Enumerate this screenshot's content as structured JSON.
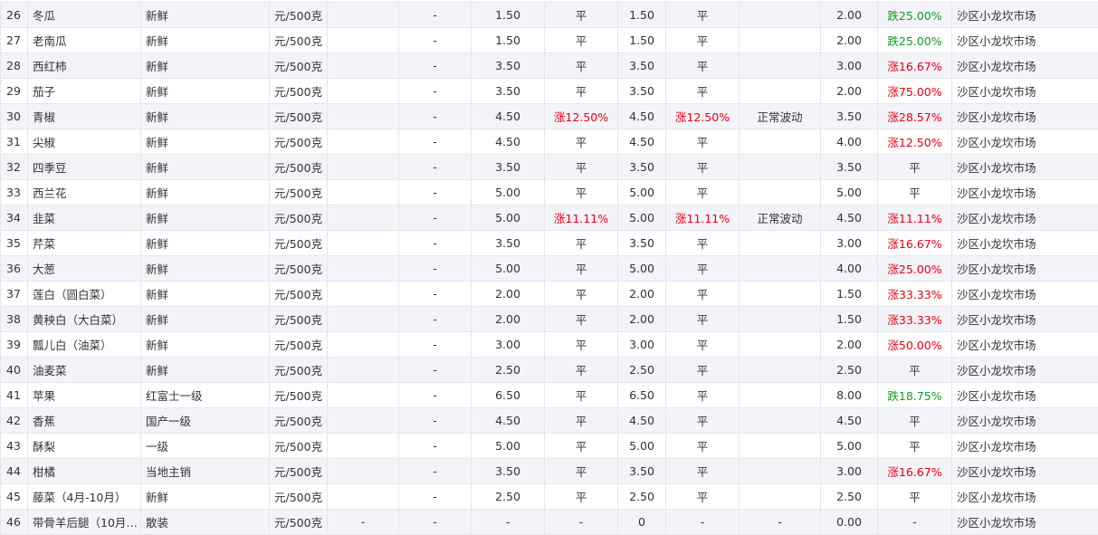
{
  "table": {
    "rows": [
      {
        "idx": "26",
        "name": "冬瓜",
        "spec": "新鲜",
        "unit": "元/500克",
        "c5": "",
        "c6": "-",
        "price1": "1.50",
        "change1": "平",
        "price2": "1.50",
        "change2": "平",
        "note": "",
        "price3": "2.00",
        "change3": "跌25.00%",
        "market": "沙区小龙坎市场"
      },
      {
        "idx": "27",
        "name": "老南瓜",
        "spec": "新鲜",
        "unit": "元/500克",
        "c5": "",
        "c6": "-",
        "price1": "1.50",
        "change1": "平",
        "price2": "1.50",
        "change2": "平",
        "note": "",
        "price3": "2.00",
        "change3": "跌25.00%",
        "market": "沙区小龙坎市场"
      },
      {
        "idx": "28",
        "name": "西红柿",
        "spec": "新鲜",
        "unit": "元/500克",
        "c5": "",
        "c6": "-",
        "price1": "3.50",
        "change1": "平",
        "price2": "3.50",
        "change2": "平",
        "note": "",
        "price3": "3.00",
        "change3": "涨16.67%",
        "market": "沙区小龙坎市场"
      },
      {
        "idx": "29",
        "name": "茄子",
        "spec": "新鲜",
        "unit": "元/500克",
        "c5": "",
        "c6": "-",
        "price1": "3.50",
        "change1": "平",
        "price2": "3.50",
        "change2": "平",
        "note": "",
        "price3": "2.00",
        "change3": "涨75.00%",
        "market": "沙区小龙坎市场"
      },
      {
        "idx": "30",
        "name": "青椒",
        "spec": "新鲜",
        "unit": "元/500克",
        "c5": "",
        "c6": "-",
        "price1": "4.50",
        "change1": "涨12.50%",
        "price2": "4.50",
        "change2": "涨12.50%",
        "note": "正常波动",
        "price3": "3.50",
        "change3": "涨28.57%",
        "market": "沙区小龙坎市场"
      },
      {
        "idx": "31",
        "name": "尖椒",
        "spec": "新鲜",
        "unit": "元/500克",
        "c5": "",
        "c6": "-",
        "price1": "4.50",
        "change1": "平",
        "price2": "4.50",
        "change2": "平",
        "note": "",
        "price3": "4.00",
        "change3": "涨12.50%",
        "market": "沙区小龙坎市场"
      },
      {
        "idx": "32",
        "name": "四季豆",
        "spec": "新鲜",
        "unit": "元/500克",
        "c5": "",
        "c6": "-",
        "price1": "3.50",
        "change1": "平",
        "price2": "3.50",
        "change2": "平",
        "note": "",
        "price3": "3.50",
        "change3": "平",
        "market": "沙区小龙坎市场"
      },
      {
        "idx": "33",
        "name": "西兰花",
        "spec": "新鲜",
        "unit": "元/500克",
        "c5": "",
        "c6": "-",
        "price1": "5.00",
        "change1": "平",
        "price2": "5.00",
        "change2": "平",
        "note": "",
        "price3": "5.00",
        "change3": "平",
        "market": "沙区小龙坎市场"
      },
      {
        "idx": "34",
        "name": "韭菜",
        "spec": "新鲜",
        "unit": "元/500克",
        "c5": "",
        "c6": "-",
        "price1": "5.00",
        "change1": "涨11.11%",
        "price2": "5.00",
        "change2": "涨11.11%",
        "note": "正常波动",
        "price3": "4.50",
        "change3": "涨11.11%",
        "market": "沙区小龙坎市场"
      },
      {
        "idx": "35",
        "name": "芹菜",
        "spec": "新鲜",
        "unit": "元/500克",
        "c5": "",
        "c6": "-",
        "price1": "3.50",
        "change1": "平",
        "price2": "3.50",
        "change2": "平",
        "note": "",
        "price3": "3.00",
        "change3": "涨16.67%",
        "market": "沙区小龙坎市场"
      },
      {
        "idx": "36",
        "name": "大葱",
        "spec": "新鲜",
        "unit": "元/500克",
        "c5": "",
        "c6": "-",
        "price1": "5.00",
        "change1": "平",
        "price2": "5.00",
        "change2": "平",
        "note": "",
        "price3": "4.00",
        "change3": "涨25.00%",
        "market": "沙区小龙坎市场"
      },
      {
        "idx": "37",
        "name": "莲白（圆白菜）",
        "spec": "新鲜",
        "unit": "元/500克",
        "c5": "",
        "c6": "-",
        "price1": "2.00",
        "change1": "平",
        "price2": "2.00",
        "change2": "平",
        "note": "",
        "price3": "1.50",
        "change3": "涨33.33%",
        "market": "沙区小龙坎市场"
      },
      {
        "idx": "38",
        "name": "黄秧白（大白菜）",
        "spec": "新鲜",
        "unit": "元/500克",
        "c5": "",
        "c6": "-",
        "price1": "2.00",
        "change1": "平",
        "price2": "2.00",
        "change2": "平",
        "note": "",
        "price3": "1.50",
        "change3": "涨33.33%",
        "market": "沙区小龙坎市场"
      },
      {
        "idx": "39",
        "name": "瓢儿白（油菜）",
        "spec": "新鲜",
        "unit": "元/500克",
        "c5": "",
        "c6": "-",
        "price1": "3.00",
        "change1": "平",
        "price2": "3.00",
        "change2": "平",
        "note": "",
        "price3": "2.00",
        "change3": "涨50.00%",
        "market": "沙区小龙坎市场"
      },
      {
        "idx": "40",
        "name": "油麦菜",
        "spec": "新鲜",
        "unit": "元/500克",
        "c5": "",
        "c6": "-",
        "price1": "2.50",
        "change1": "平",
        "price2": "2.50",
        "change2": "平",
        "note": "",
        "price3": "2.50",
        "change3": "平",
        "market": "沙区小龙坎市场"
      },
      {
        "idx": "41",
        "name": "苹果",
        "spec": "红富士一级",
        "unit": "元/500克",
        "c5": "",
        "c6": "-",
        "price1": "6.50",
        "change1": "平",
        "price2": "6.50",
        "change2": "平",
        "note": "",
        "price3": "8.00",
        "change3": "跌18.75%",
        "market": "沙区小龙坎市场"
      },
      {
        "idx": "42",
        "name": "香蕉",
        "spec": "国产一级",
        "unit": "元/500克",
        "c5": "",
        "c6": "-",
        "price1": "4.50",
        "change1": "平",
        "price2": "4.50",
        "change2": "平",
        "note": "",
        "price3": "4.50",
        "change3": "平",
        "market": "沙区小龙坎市场"
      },
      {
        "idx": "43",
        "name": "酥梨",
        "spec": "一级",
        "unit": "元/500克",
        "c5": "",
        "c6": "-",
        "price1": "5.00",
        "change1": "平",
        "price2": "5.00",
        "change2": "平",
        "note": "",
        "price3": "5.00",
        "change3": "平",
        "market": "沙区小龙坎市场"
      },
      {
        "idx": "44",
        "name": "柑橘",
        "spec": "当地主销",
        "unit": "元/500克",
        "c5": "",
        "c6": "-",
        "price1": "3.50",
        "change1": "平",
        "price2": "3.50",
        "change2": "平",
        "note": "",
        "price3": "3.00",
        "change3": "涨16.67%",
        "market": "沙区小龙坎市场"
      },
      {
        "idx": "45",
        "name": "藤菜（4月-10月）",
        "spec": "新鲜",
        "unit": "元/500克",
        "c5": "",
        "c6": "-",
        "price1": "2.50",
        "change1": "平",
        "price2": "2.50",
        "change2": "平",
        "note": "",
        "price3": "2.50",
        "change3": "平",
        "market": "沙区小龙坎市场"
      },
      {
        "idx": "46",
        "name": "带骨羊后腿（10月…",
        "spec": "散装",
        "unit": "元/500克",
        "c5": "-",
        "c6": "-",
        "price1": "-",
        "change1": "-",
        "price2": "0",
        "change2": "-",
        "note": "-",
        "price3": "0.00",
        "change3": "-",
        "market": "沙区小龙坎市场"
      }
    ]
  },
  "colors": {
    "up": "#e60012",
    "down": "#119d22",
    "stripe": "#f3f3fa",
    "border": "#e6e6ea"
  }
}
